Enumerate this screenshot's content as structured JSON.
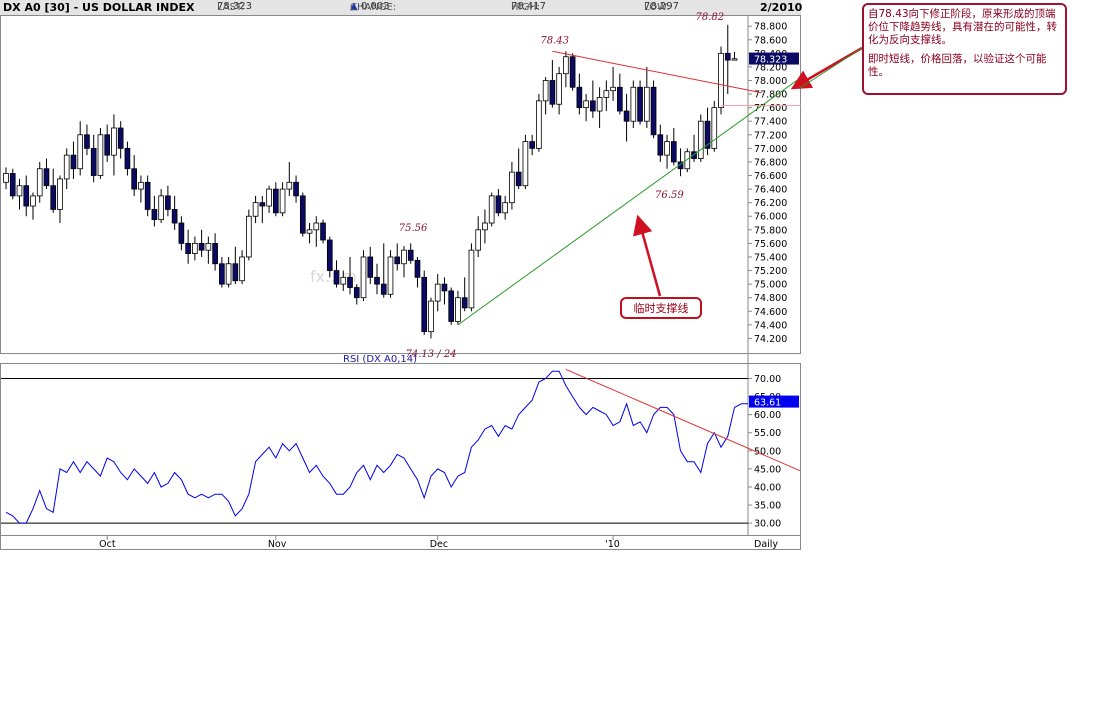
{
  "header": {
    "symbol": "DX A0 [30] - US DOLLAR INDEX",
    "last_label": "LAST:",
    "last_value": "78.323",
    "change_label": "CHANGE:",
    "change_arrow": "▲",
    "change_value": "0.003",
    "high_label": "HIGH:",
    "high_value": "78.417",
    "low_label": "LOW:",
    "low_value": "78.297",
    "date": "2/2010"
  },
  "colors": {
    "bull": "#ffffff",
    "bear": "#0b0b66",
    "rsi_line": "#0000ee",
    "resistance": "#e03030",
    "support": "#2a9a2a",
    "annot": "#8a1030"
  },
  "chart_data": [
    {
      "type": "candlestick",
      "title": "DX A0 [30] - US DOLLAR INDEX",
      "ylim": [
        74.0,
        78.95
      ],
      "y_ticks": [
        "78.800",
        "78.600",
        "78.400",
        "78.200",
        "78.000",
        "77.800",
        "77.600",
        "77.400",
        "77.200",
        "77.000",
        "76.800",
        "76.600",
        "76.400",
        "76.200",
        "76.000",
        "75.800",
        "75.600",
        "75.400",
        "75.200",
        "75.000",
        "74.800",
        "74.600",
        "74.400",
        "74.200"
      ],
      "last_price_tag": "78.323",
      "x_ticks": [
        {
          "label": "Oct",
          "index": 15
        },
        {
          "label": "Nov",
          "index": 40
        },
        {
          "label": "Dec",
          "index": 64
        },
        {
          "label": "'10",
          "index": 90
        },
        {
          "label": "Daily",
          "index": 109
        }
      ],
      "annotations": [
        {
          "text": "78.43",
          "index": 81,
          "value": 78.43
        },
        {
          "text": "78.82",
          "index": 104,
          "value": 78.82
        },
        {
          "text": "75.56",
          "index": 60,
          "value": 75.56
        },
        {
          "text": "74.13 / 24",
          "index": 61,
          "value": 74.13
        },
        {
          "text": "76.59",
          "index": 98,
          "value": 76.59
        }
      ],
      "ohlc": [
        [
          76.5,
          76.72,
          76.4,
          76.63
        ],
        [
          76.63,
          76.7,
          76.25,
          76.3
        ],
        [
          76.3,
          76.55,
          76.1,
          76.45
        ],
        [
          76.45,
          76.6,
          76.0,
          76.15
        ],
        [
          76.15,
          76.35,
          75.95,
          76.3
        ],
        [
          76.3,
          76.8,
          76.2,
          76.7
        ],
        [
          76.7,
          76.85,
          76.4,
          76.45
        ],
        [
          76.45,
          76.7,
          76.05,
          76.1
        ],
        [
          76.1,
          76.6,
          75.9,
          76.55
        ],
        [
          76.55,
          77.0,
          76.4,
          76.9
        ],
        [
          76.9,
          77.1,
          76.55,
          76.7
        ],
        [
          76.7,
          77.4,
          76.6,
          77.2
        ],
        [
          77.2,
          77.35,
          76.9,
          77.0
        ],
        [
          77.0,
          77.2,
          76.5,
          76.6
        ],
        [
          76.6,
          77.3,
          76.55,
          77.2
        ],
        [
          77.2,
          77.35,
          76.8,
          76.9
        ],
        [
          76.9,
          77.5,
          76.6,
          77.3
        ],
        [
          77.3,
          77.4,
          76.85,
          77.0
        ],
        [
          77.0,
          77.1,
          76.6,
          76.7
        ],
        [
          76.7,
          76.9,
          76.3,
          76.4
        ],
        [
          76.4,
          76.6,
          76.2,
          76.5
        ],
        [
          76.5,
          76.6,
          76.0,
          76.1
        ],
        [
          76.1,
          76.3,
          75.85,
          75.95
        ],
        [
          75.95,
          76.4,
          75.9,
          76.3
        ],
        [
          76.3,
          76.45,
          76.0,
          76.1
        ],
        [
          76.1,
          76.3,
          75.8,
          75.9
        ],
        [
          75.9,
          76.0,
          75.5,
          75.6
        ],
        [
          75.6,
          75.8,
          75.3,
          75.45
        ],
        [
          75.45,
          75.7,
          75.35,
          75.6
        ],
        [
          75.6,
          75.8,
          75.4,
          75.5
        ],
        [
          75.5,
          75.7,
          75.3,
          75.6
        ],
        [
          75.6,
          75.75,
          75.2,
          75.3
        ],
        [
          75.3,
          75.4,
          74.95,
          75.0
        ],
        [
          75.0,
          75.4,
          74.95,
          75.3
        ],
        [
          75.3,
          75.55,
          75.0,
          75.05
        ],
        [
          75.05,
          75.5,
          75.0,
          75.4
        ],
        [
          75.4,
          76.1,
          75.35,
          76.0
        ],
        [
          76.0,
          76.3,
          75.9,
          76.2
        ],
        [
          76.2,
          76.3,
          75.9,
          76.15
        ],
        [
          76.15,
          76.45,
          76.05,
          76.4
        ],
        [
          76.4,
          76.5,
          76.0,
          76.05
        ],
        [
          76.05,
          76.5,
          76.0,
          76.4
        ],
        [
          76.4,
          76.8,
          76.3,
          76.5
        ],
        [
          76.5,
          76.6,
          76.2,
          76.3
        ],
        [
          76.3,
          76.35,
          75.7,
          75.75
        ],
        [
          75.75,
          75.9,
          75.6,
          75.8
        ],
        [
          75.8,
          76.0,
          75.55,
          75.9
        ],
        [
          75.9,
          75.95,
          75.6,
          75.65
        ],
        [
          75.65,
          75.7,
          75.1,
          75.2
        ],
        [
          75.2,
          75.35,
          74.95,
          75.0
        ],
        [
          75.0,
          75.2,
          74.9,
          75.1
        ],
        [
          75.1,
          75.4,
          74.85,
          74.95
        ],
        [
          74.95,
          75.0,
          74.7,
          74.8
        ],
        [
          74.8,
          75.5,
          74.75,
          75.4
        ],
        [
          75.4,
          75.55,
          75.0,
          75.1
        ],
        [
          75.1,
          75.3,
          74.85,
          75.0
        ],
        [
          75.0,
          75.6,
          74.8,
          74.85
        ],
        [
          74.85,
          75.5,
          74.8,
          75.4
        ],
        [
          75.4,
          75.6,
          75.2,
          75.3
        ],
        [
          75.3,
          75.56,
          75.1,
          75.5
        ],
        [
          75.5,
          75.6,
          75.3,
          75.35
        ],
        [
          75.35,
          75.4,
          74.95,
          75.1
        ],
        [
          75.1,
          75.2,
          74.25,
          74.3
        ],
        [
          74.3,
          74.8,
          74.2,
          74.75
        ],
        [
          74.75,
          75.15,
          74.6,
          75.0
        ],
        [
          75.0,
          75.1,
          74.7,
          74.9
        ],
        [
          74.9,
          74.95,
          74.4,
          74.45
        ],
        [
          74.45,
          74.9,
          74.4,
          74.8
        ],
        [
          74.8,
          75.1,
          74.6,
          74.65
        ],
        [
          74.65,
          75.6,
          74.6,
          75.5
        ],
        [
          75.5,
          76.0,
          75.4,
          75.8
        ],
        [
          75.8,
          76.1,
          75.6,
          75.9
        ],
        [
          75.9,
          76.35,
          75.85,
          76.3
        ],
        [
          76.3,
          76.4,
          76.0,
          76.05
        ],
        [
          76.05,
          76.3,
          75.95,
          76.2
        ],
        [
          76.2,
          76.8,
          76.1,
          76.65
        ],
        [
          76.65,
          77.0,
          76.4,
          76.45
        ],
        [
          76.45,
          77.2,
          76.4,
          77.1
        ],
        [
          77.1,
          77.2,
          76.9,
          77.0
        ],
        [
          77.0,
          77.8,
          76.95,
          77.7
        ],
        [
          77.7,
          78.05,
          77.5,
          78.0
        ],
        [
          78.0,
          78.3,
          77.6,
          77.65
        ],
        [
          77.65,
          78.2,
          77.5,
          78.1
        ],
        [
          78.1,
          78.43,
          77.9,
          78.35
        ],
        [
          78.35,
          78.4,
          77.85,
          77.9
        ],
        [
          77.9,
          78.1,
          77.5,
          77.6
        ],
        [
          77.6,
          77.8,
          77.4,
          77.7
        ],
        [
          77.7,
          78.0,
          77.45,
          77.55
        ],
        [
          77.55,
          77.9,
          77.3,
          77.75
        ],
        [
          77.75,
          78.0,
          77.55,
          77.85
        ],
        [
          77.85,
          78.2,
          77.7,
          77.9
        ],
        [
          77.9,
          78.1,
          77.5,
          77.55
        ],
        [
          77.55,
          77.8,
          77.1,
          77.4
        ],
        [
          77.4,
          78.0,
          77.3,
          77.9
        ],
        [
          77.9,
          78.0,
          77.35,
          77.4
        ],
        [
          77.4,
          78.2,
          77.3,
          77.9
        ],
        [
          77.9,
          78.0,
          77.15,
          77.2
        ],
        [
          77.2,
          77.35,
          76.8,
          76.9
        ],
        [
          76.9,
          77.2,
          76.7,
          77.1
        ],
        [
          77.1,
          77.3,
          76.75,
          76.8
        ],
        [
          76.8,
          77.0,
          76.59,
          76.7
        ],
        [
          76.7,
          77.0,
          76.65,
          76.95
        ],
        [
          76.95,
          77.2,
          76.8,
          76.85
        ],
        [
          76.85,
          77.5,
          76.8,
          77.4
        ],
        [
          77.4,
          77.6,
          76.9,
          77.0
        ],
        [
          77.0,
          77.7,
          76.95,
          77.6
        ],
        [
          77.6,
          78.5,
          77.5,
          78.4
        ],
        [
          78.4,
          78.82,
          77.8,
          78.3
        ],
        [
          78.3,
          78.42,
          78.3,
          78.32
        ]
      ],
      "trendlines": [
        {
          "name": "resistance",
          "from": [
            81,
            78.43
          ],
          "to": [
            112,
            77.82
          ]
        },
        {
          "name": "support",
          "from": [
            67,
            74.4
          ],
          "to": [
            120,
            78.2
          ]
        }
      ],
      "resistance_extension_level": 77.63
    },
    {
      "type": "line",
      "title": "RSI (DX A0,14)",
      "ylim": [
        27,
        74
      ],
      "y_ticks": [
        "70.00",
        "65.00",
        "60.00",
        "55.00",
        "50.00",
        "45.00",
        "40.00",
        "35.00",
        "30.00"
      ],
      "reference_lines": [
        30,
        70
      ],
      "last_value_tag": "63.61",
      "values": [
        33,
        32,
        30,
        30,
        34,
        39,
        34,
        33,
        45,
        44,
        47,
        44,
        47,
        45,
        43,
        48,
        47,
        44,
        42,
        45,
        43,
        41,
        44,
        40,
        41,
        44,
        42,
        38,
        37,
        38,
        37,
        38,
        38,
        36,
        32,
        34,
        38,
        47,
        49,
        51,
        48,
        52,
        50,
        52,
        48,
        44,
        46,
        43,
        41,
        38,
        38,
        40,
        44,
        46,
        42,
        46,
        44,
        46,
        49,
        48,
        45,
        42,
        37,
        43,
        45,
        44,
        40,
        43,
        44,
        51,
        53,
        56,
        57,
        54,
        57,
        56,
        60,
        62,
        64,
        69,
        70,
        72,
        72,
        68,
        65,
        62,
        60,
        62,
        61,
        60,
        57,
        58,
        63,
        57,
        58,
        55,
        60,
        62,
        62,
        60,
        50,
        47,
        47,
        44,
        52,
        55,
        51,
        54,
        62,
        63,
        63
      ]
    }
  ],
  "callout": {
    "line1": "自78.43向下修正阶段，原来形成的顶端价位下降趋势线，具有潜在的可能性，转化为反向支撑线。",
    "line2": "即时短线，价格回落，以验证这个可能性。"
  },
  "support_label": "临时支撑线",
  "watermark": "fx…m"
}
